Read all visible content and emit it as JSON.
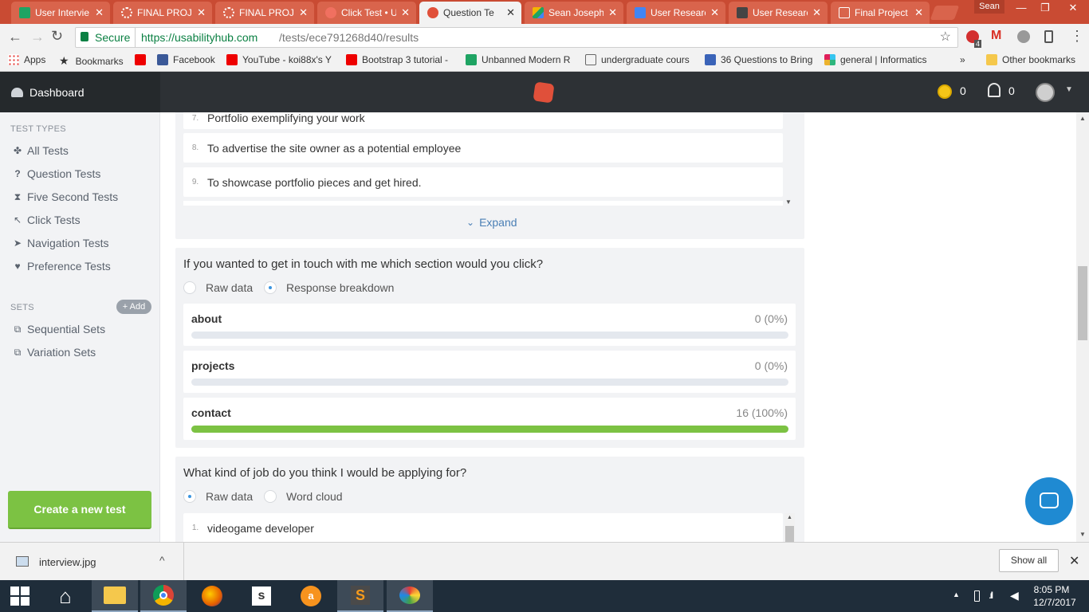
{
  "browser": {
    "tabs": [
      {
        "label": "User Intervie",
        "icon": "sheets-icon",
        "color": "#1fa463"
      },
      {
        "label": "FINAL PROJE",
        "icon": "loading-icon",
        "color": "#e0503a"
      },
      {
        "label": "FINAL PROJE",
        "icon": "loading-icon",
        "color": "#e0503a"
      },
      {
        "label": "Click Test • U",
        "icon": "usabilityhub-icon",
        "color": "#e0503a"
      },
      {
        "label": "Question Te",
        "icon": "usabilityhub-icon",
        "color": "#e0503a"
      },
      {
        "label": "Sean Joseph",
        "icon": "drive-icon",
        "color": "#f4b400"
      },
      {
        "label": "User Researc",
        "icon": "docs-icon",
        "color": "#4285f4"
      },
      {
        "label": "User Researc",
        "icon": "image-icon",
        "color": "#444444"
      },
      {
        "label": "Final Project",
        "icon": "page-icon",
        "color": "#888888"
      }
    ],
    "active_tab_index": 4,
    "profile_name": "Sean",
    "secure_label": "Secure",
    "url_host": "https://usabilityhub.com",
    "url_path": "/tests/ece791268d40/results",
    "extension_badge": "4",
    "bookmarks": [
      {
        "label": "Apps",
        "icon": "apps-grid-icon"
      },
      {
        "label": "Bookmarks",
        "icon": "star-icon"
      },
      {
        "label": "",
        "icon": "youtube-icon"
      },
      {
        "label": "Facebook",
        "icon": "facebook-icon"
      },
      {
        "label": "YouTube - koi88x's Y",
        "icon": "youtube-icon"
      },
      {
        "label": "Bootstrap 3 tutorial -",
        "icon": "youtube-icon"
      },
      {
        "label": "Unbanned Modern R",
        "icon": "sheets-icon"
      },
      {
        "label": "undergraduate cours",
        "icon": "page-icon"
      },
      {
        "label": "36 Questions to Bring",
        "icon": "pt-icon"
      },
      {
        "label": "general | Informatics",
        "icon": "slack-icon"
      }
    ],
    "bookmarks_more": "»",
    "other_bookmarks": "Other bookmarks"
  },
  "header": {
    "dashboard_label": "Dashboard",
    "credits_count": "0",
    "notifications_count": "0"
  },
  "sidebar": {
    "test_types_heading": "TEST TYPES",
    "test_types": [
      {
        "label": "All Tests",
        "icon": "all-tests-icon"
      },
      {
        "label": "Question Tests",
        "icon": "question-icon"
      },
      {
        "label": "Five Second Tests",
        "icon": "hourglass-icon"
      },
      {
        "label": "Click Tests",
        "icon": "cursor-icon"
      },
      {
        "label": "Navigation Tests",
        "icon": "navigation-icon"
      },
      {
        "label": "Preference Tests",
        "icon": "heart-icon"
      }
    ],
    "sets_heading": "SETS",
    "add_label": "+ Add",
    "sets": [
      {
        "label": "Sequential Sets",
        "icon": "sequential-icon"
      },
      {
        "label": "Variation Sets",
        "icon": "variation-icon"
      }
    ],
    "create_button": "Create a new test"
  },
  "content": {
    "prev_card": {
      "items": [
        {
          "num": "7.",
          "text": "Portfolio exemplifying your work"
        },
        {
          "num": "8.",
          "text": "To advertise the site owner as a potential employee"
        },
        {
          "num": "9.",
          "text": "To showcase portfolio pieces and get hired."
        }
      ],
      "expand_label": "Expand"
    },
    "question2": {
      "title": "If you wanted to get in touch with me which section would you click?",
      "radio_raw": "Raw data",
      "radio_breakdown": "Response breakdown",
      "selected": "Response breakdown",
      "options": [
        {
          "label": "about",
          "value": "0 (0%)",
          "fraction": 0
        },
        {
          "label": "projects",
          "value": "0 (0%)",
          "fraction": 0
        },
        {
          "label": "contact",
          "value": "16 (100%)",
          "fraction": 1
        }
      ]
    },
    "question3": {
      "title": "What kind of job do you think I would be applying for?",
      "radio_raw": "Raw data",
      "radio_cloud": "Word cloud",
      "selected": "Raw data",
      "items": [
        {
          "num": "1.",
          "text": "videogame developer"
        }
      ]
    }
  },
  "download_bar": {
    "file_name": "interview.jpg",
    "show_all": "Show all"
  },
  "taskbar": {
    "time": "8:05 PM",
    "date": "12/7/2017"
  },
  "colors": {
    "chrome_frame": "#c94b33",
    "app_header": "#2d3135",
    "accent_green": "#7cc243",
    "radio_blue": "#3a95e0",
    "chat_blue": "#1f8ad2"
  }
}
